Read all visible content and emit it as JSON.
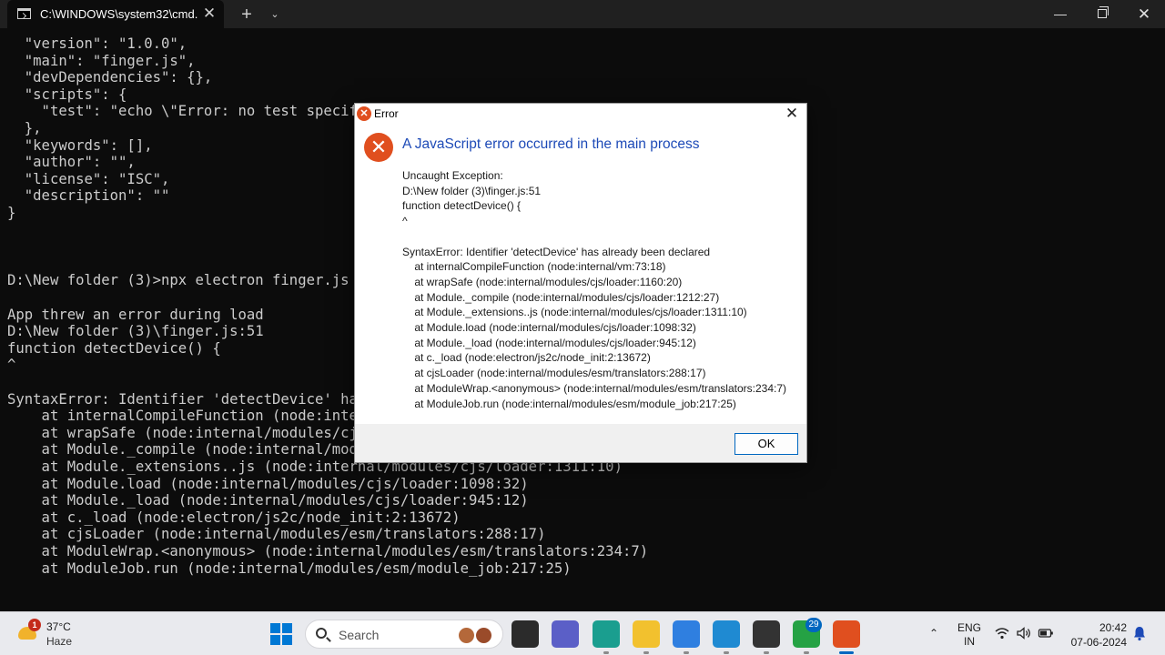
{
  "window": {
    "tab_title": "C:\\WINDOWS\\system32\\cmd.",
    "close_glyph": "✕",
    "new_tab_glyph": "+",
    "dropdown_glyph": "⌄",
    "minimize_glyph": "—",
    "close_window_glyph": "✕"
  },
  "terminal": {
    "lines": [
      "  \"version\": \"1.0.0\",",
      "  \"main\": \"finger.js\",",
      "  \"devDependencies\": {},",
      "  \"scripts\": {",
      "    \"test\": \"echo \\\"Error: no test specif",
      "  },",
      "  \"keywords\": [],",
      "  \"author\": \"\",",
      "  \"license\": \"ISC\",",
      "  \"description\": \"\"",
      "}",
      "",
      "",
      "",
      "D:\\New folder (3)>npx electron finger.js",
      "",
      "App threw an error during load",
      "D:\\New folder (3)\\finger.js:51",
      "function detectDevice() {",
      "^",
      "",
      "SyntaxError: Identifier 'detectDevice' ha",
      "    at internalCompileFunction (node:inte",
      "    at wrapSafe (node:internal/modules/cj",
      "    at Module._compile (node:internal/mod",
      "    at Module._extensions..js (node:internal/modules/cjs/loader:1311:10)",
      "    at Module.load (node:internal/modules/cjs/loader:1098:32)",
      "    at Module._load (node:internal/modules/cjs/loader:945:12)",
      "    at c._load (node:electron/js2c/node_init:2:13672)",
      "    at cjsLoader (node:internal/modules/esm/translators:288:17)",
      "    at ModuleWrap.<anonymous> (node:internal/modules/esm/translators:234:7)",
      "    at ModuleJob.run (node:internal/modules/esm/module_job:217:25)"
    ]
  },
  "dialog": {
    "title": "Error",
    "close_glyph": "✕",
    "icon_glyph": "✕",
    "heading": "A JavaScript error occurred in the main process",
    "message_lines": [
      "Uncaught Exception:",
      "D:\\New folder (3)\\finger.js:51",
      "function detectDevice() {",
      "^",
      "",
      "SyntaxError: Identifier 'detectDevice' has already been declared",
      "    at internalCompileFunction (node:internal/vm:73:18)",
      "    at wrapSafe (node:internal/modules/cjs/loader:1160:20)",
      "    at Module._compile (node:internal/modules/cjs/loader:1212:27)",
      "    at Module._extensions..js (node:internal/modules/cjs/loader:1311:10)",
      "    at Module.load (node:internal/modules/cjs/loader:1098:32)",
      "    at Module._load (node:internal/modules/cjs/loader:945:12)",
      "    at c._load (node:electron/js2c/node_init:2:13672)",
      "    at cjsLoader (node:internal/modules/esm/translators:288:17)",
      "    at ModuleWrap.<anonymous> (node:internal/modules/esm/translators:234:7)",
      "    at ModuleJob.run (node:internal/modules/esm/module_job:217:25)"
    ],
    "ok_label": "OK"
  },
  "taskbar": {
    "weather": {
      "temp": "37°C",
      "condition": "Haze",
      "badge": "1"
    },
    "search_placeholder": "Search",
    "apps": [
      {
        "name": "task-view-app",
        "color": "#2b2b2b"
      },
      {
        "name": "teams-meet-app",
        "color": "#5b5fc7"
      },
      {
        "name": "edge-app",
        "color": "#1a9e8f"
      },
      {
        "name": "file-explorer-app",
        "color": "#f2c12e"
      },
      {
        "name": "store-app",
        "color": "#2f7fe0"
      },
      {
        "name": "vscode-app",
        "color": "#1f8ad2"
      },
      {
        "name": "terminal-app",
        "color": "#333333"
      },
      {
        "name": "whatsapp-app",
        "color": "#25a244",
        "badge": "29"
      },
      {
        "name": "electron-error-app",
        "color": "#e04f1f"
      }
    ],
    "lang_line1": "ENG",
    "lang_line2": "IN",
    "time": "20:42",
    "date": "07-06-2024",
    "chevron_glyph": "⌃"
  }
}
